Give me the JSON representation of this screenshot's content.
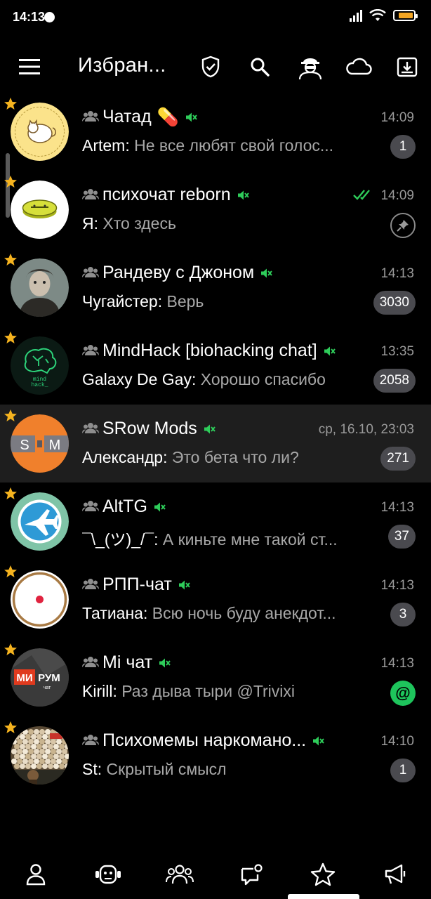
{
  "status_bar": {
    "time": "14:13",
    "battery_color": "#f5a623"
  },
  "toolbar": {
    "title": "Избран...",
    "icons": [
      "menu-icon",
      "shield-icon",
      "search-icon",
      "incognito-icon",
      "cloud-icon",
      "archive-icon"
    ]
  },
  "colors": {
    "star": "#f5b31f",
    "mute": "#2ecc5a",
    "read_ticks": "#2ecc5a",
    "mention": "#1ec45c",
    "badge": "#4a4a4f",
    "selected_row": "#1e1e1e"
  },
  "chats": [
    {
      "title": "Чатад",
      "emoji": "💊",
      "time": "14:09",
      "sender": "Artem:",
      "message": " Не все любят свой голос...",
      "badge": "1",
      "avatar": "cat-avatar"
    },
    {
      "title": "психочат reborn",
      "time": "14:09",
      "sender": "Я:",
      "message": " Хто здесь",
      "status": "read-double-check",
      "badge_type": "pinned",
      "avatar": "pill-avatar"
    },
    {
      "title": "Рандеву с Джоном",
      "time": "14:13",
      "sender": "Чугайстер:",
      "message": " Верь",
      "badge": "3030",
      "avatar": "portrait-avatar"
    },
    {
      "title": "MindHack [biohacking chat]",
      "time": "13:35",
      "sender": "Galaxy De Gay:",
      "message": " Хорошо спасибо",
      "badge": "2058",
      "avatar": "brain-avatar"
    },
    {
      "title": "SRow Mods",
      "time": "ср, 16.10, 23:03",
      "sender": "Александр:",
      "message": " Это бета что ли?",
      "badge": "271",
      "avatar": "srow-avatar",
      "selected": true
    },
    {
      "title": "AltTG",
      "time": "14:13",
      "sender": "¯\\_(ツ)_/¯:",
      "message": " А киньте мне такой ст...",
      "badge": "37",
      "avatar": "plane-avatar"
    },
    {
      "title": "РПП-чат",
      "time": "14:13",
      "sender": "Татиана:",
      "message": " Всю ночь буду анекдот...",
      "badge": "3",
      "avatar": "circle-avatar"
    },
    {
      "title": "Mi чат",
      "time": "14:13",
      "sender": "Kirill:",
      "message": " Раз дыва тыри @Trivixi",
      "badge_type": "mention",
      "badge": "@",
      "avatar": "mi-avatar"
    },
    {
      "title": "Психомемы наркомано...",
      "time": "14:10",
      "sender": "St:",
      "message": " Скрытый смысл",
      "badge": "1",
      "avatar": "crowd-avatar"
    }
  ],
  "avatar_text": {
    "srow_left": "S",
    "srow_right": "M",
    "mi_main": "МИ РУМ",
    "mi_sub": "чат"
  },
  "bottom_nav": {
    "items": [
      "contacts-icon",
      "bots-icon",
      "groups-icon",
      "channels-chat-icon",
      "favorites-star-icon",
      "megaphone-icon"
    ],
    "active_index": 4
  }
}
